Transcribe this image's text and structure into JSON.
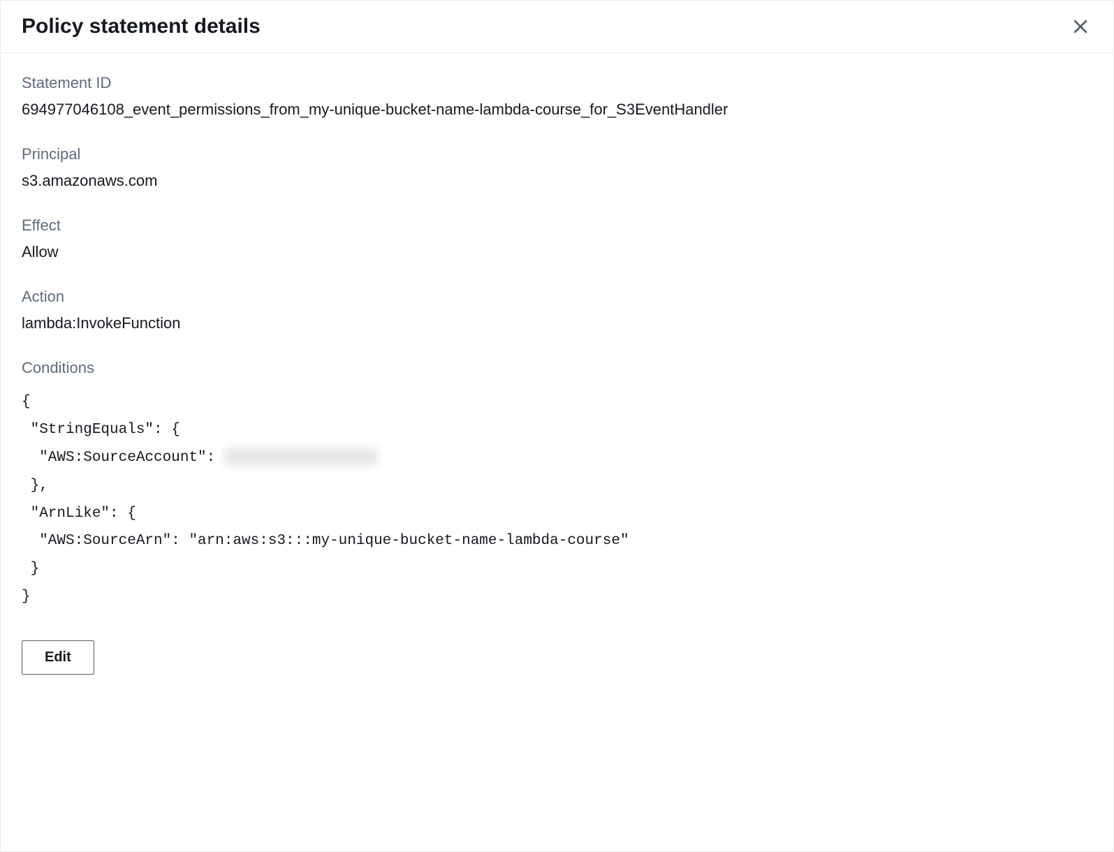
{
  "header": {
    "title": "Policy statement details"
  },
  "fields": {
    "statement_id": {
      "label": "Statement ID",
      "value": "694977046108_event_permissions_from_my-unique-bucket-name-lambda-course_for_S3EventHandler"
    },
    "principal": {
      "label": "Principal",
      "value": "s3.amazonaws.com"
    },
    "effect": {
      "label": "Effect",
      "value": "Allow"
    },
    "action": {
      "label": "Action",
      "value": "lambda:InvokeFunction"
    },
    "conditions": {
      "label": "Conditions",
      "lines": {
        "l0": "{",
        "l1": " \"StringEquals\": {",
        "l2_pre": "  \"AWS:SourceAccount\": ",
        "l3": " },",
        "l4": " \"ArnLike\": {",
        "l5": "  \"AWS:SourceArn\": \"arn:aws:s3:::my-unique-bucket-name-lambda-course\"",
        "l6": " }",
        "l7": "}"
      }
    }
  },
  "buttons": {
    "edit": "Edit"
  }
}
